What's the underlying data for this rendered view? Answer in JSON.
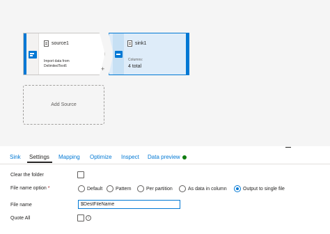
{
  "canvas": {
    "source_node": {
      "title": "source1",
      "subtitle_line1": "Import data from",
      "subtitle_line2": "DelimitedText6"
    },
    "sink_node": {
      "title": "sink1",
      "columns_label": "Columns:",
      "columns_value": "4 total"
    },
    "add_connector": "+",
    "add_source_label": "Add Source"
  },
  "tabs": [
    {
      "label": "Sink"
    },
    {
      "label": "Settings"
    },
    {
      "label": "Mapping"
    },
    {
      "label": "Optimize"
    },
    {
      "label": "Inspect"
    },
    {
      "label": "Data preview"
    }
  ],
  "active_tab": "Settings",
  "data_preview_status_color": "#107c10",
  "settings": {
    "clear_folder": {
      "label": "Clear the folder",
      "checked": false
    },
    "file_name_option": {
      "label": "File name option",
      "required_mark": "*",
      "options": [
        "Default",
        "Pattern",
        "Per partition",
        "As data in column",
        "Output to single file"
      ],
      "selected": "Output to single file"
    },
    "file_name": {
      "label": "File name",
      "value": "$DestFileName"
    },
    "quote_all": {
      "label": "Quote All",
      "checked": false,
      "info_icon": "info-icon"
    }
  },
  "colors": {
    "accent": "#0078d4",
    "sink_fill": "#deecf9",
    "required": "#a4262c"
  }
}
